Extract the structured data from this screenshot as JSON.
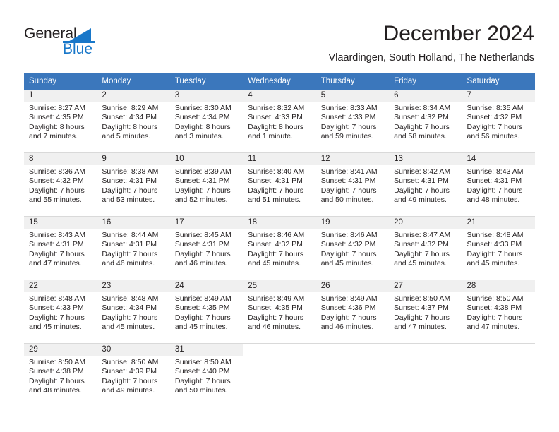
{
  "brand": {
    "name_part1": "General",
    "name_part2": "Blue",
    "accent_color": "#1877c9",
    "logo_icon": "triangle-flag-icon"
  },
  "header": {
    "title": "December 2024",
    "subtitle": "Vlaardingen, South Holland, The Netherlands"
  },
  "calendar": {
    "header_bg": "#3b77bc",
    "daynum_bg": "#f0f0f0",
    "weekdays": [
      "Sunday",
      "Monday",
      "Tuesday",
      "Wednesday",
      "Thursday",
      "Friday",
      "Saturday"
    ],
    "weeks": [
      [
        {
          "day": "1",
          "sunrise": "Sunrise: 8:27 AM",
          "sunset": "Sunset: 4:35 PM",
          "daylight_1": "Daylight: 8 hours",
          "daylight_2": "and 7 minutes."
        },
        {
          "day": "2",
          "sunrise": "Sunrise: 8:29 AM",
          "sunset": "Sunset: 4:34 PM",
          "daylight_1": "Daylight: 8 hours",
          "daylight_2": "and 5 minutes."
        },
        {
          "day": "3",
          "sunrise": "Sunrise: 8:30 AM",
          "sunset": "Sunset: 4:34 PM",
          "daylight_1": "Daylight: 8 hours",
          "daylight_2": "and 3 minutes."
        },
        {
          "day": "4",
          "sunrise": "Sunrise: 8:32 AM",
          "sunset": "Sunset: 4:33 PM",
          "daylight_1": "Daylight: 8 hours",
          "daylight_2": "and 1 minute."
        },
        {
          "day": "5",
          "sunrise": "Sunrise: 8:33 AM",
          "sunset": "Sunset: 4:33 PM",
          "daylight_1": "Daylight: 7 hours",
          "daylight_2": "and 59 minutes."
        },
        {
          "day": "6",
          "sunrise": "Sunrise: 8:34 AM",
          "sunset": "Sunset: 4:32 PM",
          "daylight_1": "Daylight: 7 hours",
          "daylight_2": "and 58 minutes."
        },
        {
          "day": "7",
          "sunrise": "Sunrise: 8:35 AM",
          "sunset": "Sunset: 4:32 PM",
          "daylight_1": "Daylight: 7 hours",
          "daylight_2": "and 56 minutes."
        }
      ],
      [
        {
          "day": "8",
          "sunrise": "Sunrise: 8:36 AM",
          "sunset": "Sunset: 4:32 PM",
          "daylight_1": "Daylight: 7 hours",
          "daylight_2": "and 55 minutes."
        },
        {
          "day": "9",
          "sunrise": "Sunrise: 8:38 AM",
          "sunset": "Sunset: 4:31 PM",
          "daylight_1": "Daylight: 7 hours",
          "daylight_2": "and 53 minutes."
        },
        {
          "day": "10",
          "sunrise": "Sunrise: 8:39 AM",
          "sunset": "Sunset: 4:31 PM",
          "daylight_1": "Daylight: 7 hours",
          "daylight_2": "and 52 minutes."
        },
        {
          "day": "11",
          "sunrise": "Sunrise: 8:40 AM",
          "sunset": "Sunset: 4:31 PM",
          "daylight_1": "Daylight: 7 hours",
          "daylight_2": "and 51 minutes."
        },
        {
          "day": "12",
          "sunrise": "Sunrise: 8:41 AM",
          "sunset": "Sunset: 4:31 PM",
          "daylight_1": "Daylight: 7 hours",
          "daylight_2": "and 50 minutes."
        },
        {
          "day": "13",
          "sunrise": "Sunrise: 8:42 AM",
          "sunset": "Sunset: 4:31 PM",
          "daylight_1": "Daylight: 7 hours",
          "daylight_2": "and 49 minutes."
        },
        {
          "day": "14",
          "sunrise": "Sunrise: 8:43 AM",
          "sunset": "Sunset: 4:31 PM",
          "daylight_1": "Daylight: 7 hours",
          "daylight_2": "and 48 minutes."
        }
      ],
      [
        {
          "day": "15",
          "sunrise": "Sunrise: 8:43 AM",
          "sunset": "Sunset: 4:31 PM",
          "daylight_1": "Daylight: 7 hours",
          "daylight_2": "and 47 minutes."
        },
        {
          "day": "16",
          "sunrise": "Sunrise: 8:44 AM",
          "sunset": "Sunset: 4:31 PM",
          "daylight_1": "Daylight: 7 hours",
          "daylight_2": "and 46 minutes."
        },
        {
          "day": "17",
          "sunrise": "Sunrise: 8:45 AM",
          "sunset": "Sunset: 4:31 PM",
          "daylight_1": "Daylight: 7 hours",
          "daylight_2": "and 46 minutes."
        },
        {
          "day": "18",
          "sunrise": "Sunrise: 8:46 AM",
          "sunset": "Sunset: 4:32 PM",
          "daylight_1": "Daylight: 7 hours",
          "daylight_2": "and 45 minutes."
        },
        {
          "day": "19",
          "sunrise": "Sunrise: 8:46 AM",
          "sunset": "Sunset: 4:32 PM",
          "daylight_1": "Daylight: 7 hours",
          "daylight_2": "and 45 minutes."
        },
        {
          "day": "20",
          "sunrise": "Sunrise: 8:47 AM",
          "sunset": "Sunset: 4:32 PM",
          "daylight_1": "Daylight: 7 hours",
          "daylight_2": "and 45 minutes."
        },
        {
          "day": "21",
          "sunrise": "Sunrise: 8:48 AM",
          "sunset": "Sunset: 4:33 PM",
          "daylight_1": "Daylight: 7 hours",
          "daylight_2": "and 45 minutes."
        }
      ],
      [
        {
          "day": "22",
          "sunrise": "Sunrise: 8:48 AM",
          "sunset": "Sunset: 4:33 PM",
          "daylight_1": "Daylight: 7 hours",
          "daylight_2": "and 45 minutes."
        },
        {
          "day": "23",
          "sunrise": "Sunrise: 8:48 AM",
          "sunset": "Sunset: 4:34 PM",
          "daylight_1": "Daylight: 7 hours",
          "daylight_2": "and 45 minutes."
        },
        {
          "day": "24",
          "sunrise": "Sunrise: 8:49 AM",
          "sunset": "Sunset: 4:35 PM",
          "daylight_1": "Daylight: 7 hours",
          "daylight_2": "and 45 minutes."
        },
        {
          "day": "25",
          "sunrise": "Sunrise: 8:49 AM",
          "sunset": "Sunset: 4:35 PM",
          "daylight_1": "Daylight: 7 hours",
          "daylight_2": "and 46 minutes."
        },
        {
          "day": "26",
          "sunrise": "Sunrise: 8:49 AM",
          "sunset": "Sunset: 4:36 PM",
          "daylight_1": "Daylight: 7 hours",
          "daylight_2": "and 46 minutes."
        },
        {
          "day": "27",
          "sunrise": "Sunrise: 8:50 AM",
          "sunset": "Sunset: 4:37 PM",
          "daylight_1": "Daylight: 7 hours",
          "daylight_2": "and 47 minutes."
        },
        {
          "day": "28",
          "sunrise": "Sunrise: 8:50 AM",
          "sunset": "Sunset: 4:38 PM",
          "daylight_1": "Daylight: 7 hours",
          "daylight_2": "and 47 minutes."
        }
      ],
      [
        {
          "day": "29",
          "sunrise": "Sunrise: 8:50 AM",
          "sunset": "Sunset: 4:38 PM",
          "daylight_1": "Daylight: 7 hours",
          "daylight_2": "and 48 minutes."
        },
        {
          "day": "30",
          "sunrise": "Sunrise: 8:50 AM",
          "sunset": "Sunset: 4:39 PM",
          "daylight_1": "Daylight: 7 hours",
          "daylight_2": "and 49 minutes."
        },
        {
          "day": "31",
          "sunrise": "Sunrise: 8:50 AM",
          "sunset": "Sunset: 4:40 PM",
          "daylight_1": "Daylight: 7 hours",
          "daylight_2": "and 50 minutes."
        },
        {
          "day": "",
          "sunrise": "",
          "sunset": "",
          "daylight_1": "",
          "daylight_2": ""
        },
        {
          "day": "",
          "sunrise": "",
          "sunset": "",
          "daylight_1": "",
          "daylight_2": ""
        },
        {
          "day": "",
          "sunrise": "",
          "sunset": "",
          "daylight_1": "",
          "daylight_2": ""
        },
        {
          "day": "",
          "sunrise": "",
          "sunset": "",
          "daylight_1": "",
          "daylight_2": ""
        }
      ]
    ]
  }
}
